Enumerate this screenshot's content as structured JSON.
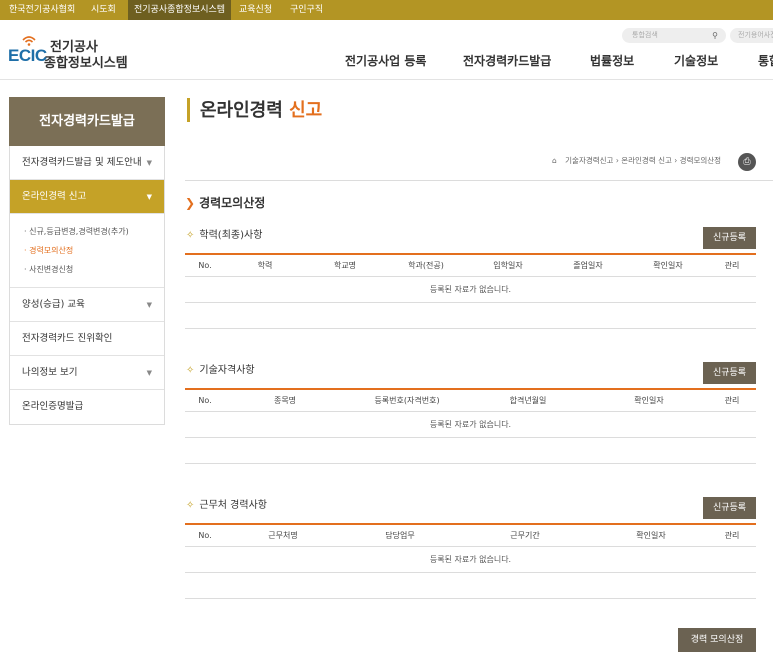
{
  "topbar": {
    "items": [
      "한국전기공사협회",
      "시도회",
      "전기공사종합정보시스템",
      "교육신청",
      "구인구직"
    ]
  },
  "header": {
    "logo_ecic": "ECIC",
    "logo_line1": "전기공사",
    "logo_line2": "종합정보시스템",
    "search_placeholder": "통합검색",
    "search2_text": "전기용어사전",
    "nav": [
      "전기공사업 등록",
      "전자경력카드발급",
      "법률정보",
      "기술정보",
      "통합"
    ]
  },
  "sidebar": {
    "title": "전자경력카드발급",
    "items": [
      {
        "label": "전자경력카드발급 및 제도안내"
      },
      {
        "label": "온라인경력 신고"
      },
      {
        "label": "양성(승급) 교육"
      },
      {
        "label": "전자경력카드 진위확인"
      },
      {
        "label": "나의정보 보기"
      },
      {
        "label": "온라인증명발급"
      }
    ],
    "subitems": [
      "· 신규,등급변경,경력변경(추가)",
      "· 경력모의산정",
      "· 사진변경신청"
    ]
  },
  "content": {
    "title_main": "온라인경력 ",
    "title_highlight": "신고",
    "breadcrumb": "기술자경력신고 › 온라인경력 신고 › 경력모의산정",
    "section_title": "경력모의산정",
    "new_button": "신규등록",
    "empty_text": "등록된 자료가 없습니다.",
    "calc_button": "경력 모의산정",
    "tables": [
      {
        "title": "학력(최종)사항",
        "headers": [
          "No.",
          "학력",
          "학교명",
          "학과(전공)",
          "입학일자",
          "졸업일자",
          "확인일자",
          "관리"
        ]
      },
      {
        "title": "기술자격사항",
        "headers": [
          "No.",
          "종목명",
          "등록번호(자격번호)",
          "합격년월일",
          "확인일자",
          "관리"
        ]
      },
      {
        "title": "근무처 경력사항",
        "headers": [
          "No.",
          "근무처명",
          "담당업무",
          "근무기간",
          "확인일자",
          "관리"
        ]
      }
    ]
  },
  "colors": {
    "gold": "#c5a227",
    "orange_accent": "#e36f1e",
    "button_brown": "#6b6252",
    "sidebar_title_bg": "#7b6f56"
  }
}
